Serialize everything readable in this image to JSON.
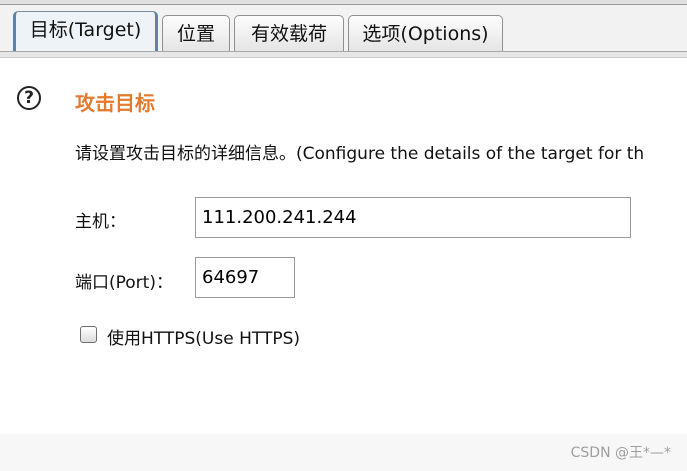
{
  "tabs": [
    {
      "label": "目标(Target)",
      "active": true
    },
    {
      "label": "位置",
      "active": false
    },
    {
      "label": "有效载荷",
      "active": false
    },
    {
      "label": "选项(Options)",
      "active": false
    }
  ],
  "section": {
    "title": "攻击目标",
    "description": "请设置攻击目标的详细信息。(Configure the details of the target for th"
  },
  "form": {
    "host_label": "主机：",
    "host_value": "111.200.241.244",
    "port_label": "端口(Port)：",
    "port_value": "64697",
    "https_label": "使用HTTPS(Use HTTPS)",
    "https_checked": false
  },
  "watermark": "CSDN @王*—*",
  "colors": {
    "section_title": "#e27a2f",
    "active_tab_border": "#5c83a8"
  }
}
